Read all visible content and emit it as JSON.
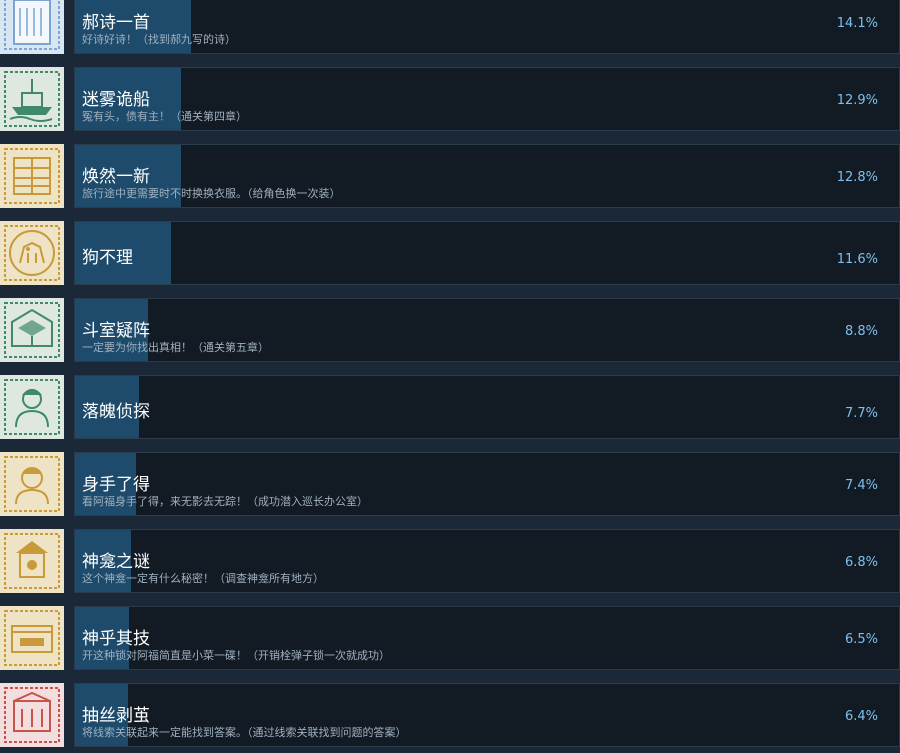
{
  "achievements": [
    {
      "title": "郝诗一首",
      "description": "好诗好诗！（找到郝九写的诗）",
      "percent_label": "14.1%",
      "percent": 14.1,
      "icon": "poem-scroll-icon",
      "icon_color": "#7aa6d6",
      "frame_color": "#d8e6f2"
    },
    {
      "title": "迷雾诡船",
      "description": "冤有头，债有主！（通关第四章）",
      "percent_label": "12.9%",
      "percent": 12.9,
      "icon": "ship-icon",
      "icon_color": "#3f8a6a",
      "frame_color": "#dfe8e0"
    },
    {
      "title": "焕然一新",
      "description": "旅行途中更需要时不时换换衣服。（给角色换一次装）",
      "percent_label": "12.8%",
      "percent": 12.8,
      "icon": "wardrobe-icon",
      "icon_color": "#c99a3a",
      "frame_color": "#efe3c6"
    },
    {
      "title": "狗不理",
      "description": "",
      "percent_label": "11.6%",
      "percent": 11.6,
      "icon": "dog-icon",
      "icon_color": "#c99a3a",
      "frame_color": "#efe3c6"
    },
    {
      "title": "斗室疑阵",
      "description": "一定要为你找出真相！（通关第五章）",
      "percent_label": "8.8%",
      "percent": 8.8,
      "icon": "room-icon",
      "icon_color": "#3f8a6a",
      "frame_color": "#dfe8e0"
    },
    {
      "title": "落魄侦探",
      "description": "",
      "percent_label": "7.7%",
      "percent": 7.7,
      "icon": "detective-icon",
      "icon_color": "#3f8a6a",
      "frame_color": "#dfe8e0"
    },
    {
      "title": "身手了得",
      "description": "看阿福身手了得，来无影去无踪！（成功潜入巡长办公室）",
      "percent_label": "7.4%",
      "percent": 7.4,
      "icon": "portrait-icon",
      "icon_color": "#c99a3a",
      "frame_color": "#efe3c6"
    },
    {
      "title": "神龛之谜",
      "description": "这个神龛一定有什么秘密！（调查神龛所有地方）",
      "percent_label": "6.8%",
      "percent": 6.8,
      "icon": "shrine-icon",
      "icon_color": "#c99a3a",
      "frame_color": "#efe3c6"
    },
    {
      "title": "神乎其技",
      "description": "开这种锁对阿福简直是小菜一碟！（开销栓弹子锁一次就成功）",
      "percent_label": "6.5%",
      "percent": 6.5,
      "icon": "lock-box-icon",
      "icon_color": "#c99a3a",
      "frame_color": "#efe3c6"
    },
    {
      "title": "抽丝剥茧",
      "description": "将线索关联起来一定能找到答案。（通过线索关联找到问题的答案）",
      "percent_label": "6.4%",
      "percent": 6.4,
      "icon": "building-icon",
      "icon_color": "#c9524a",
      "frame_color": "#f2dede"
    }
  ]
}
